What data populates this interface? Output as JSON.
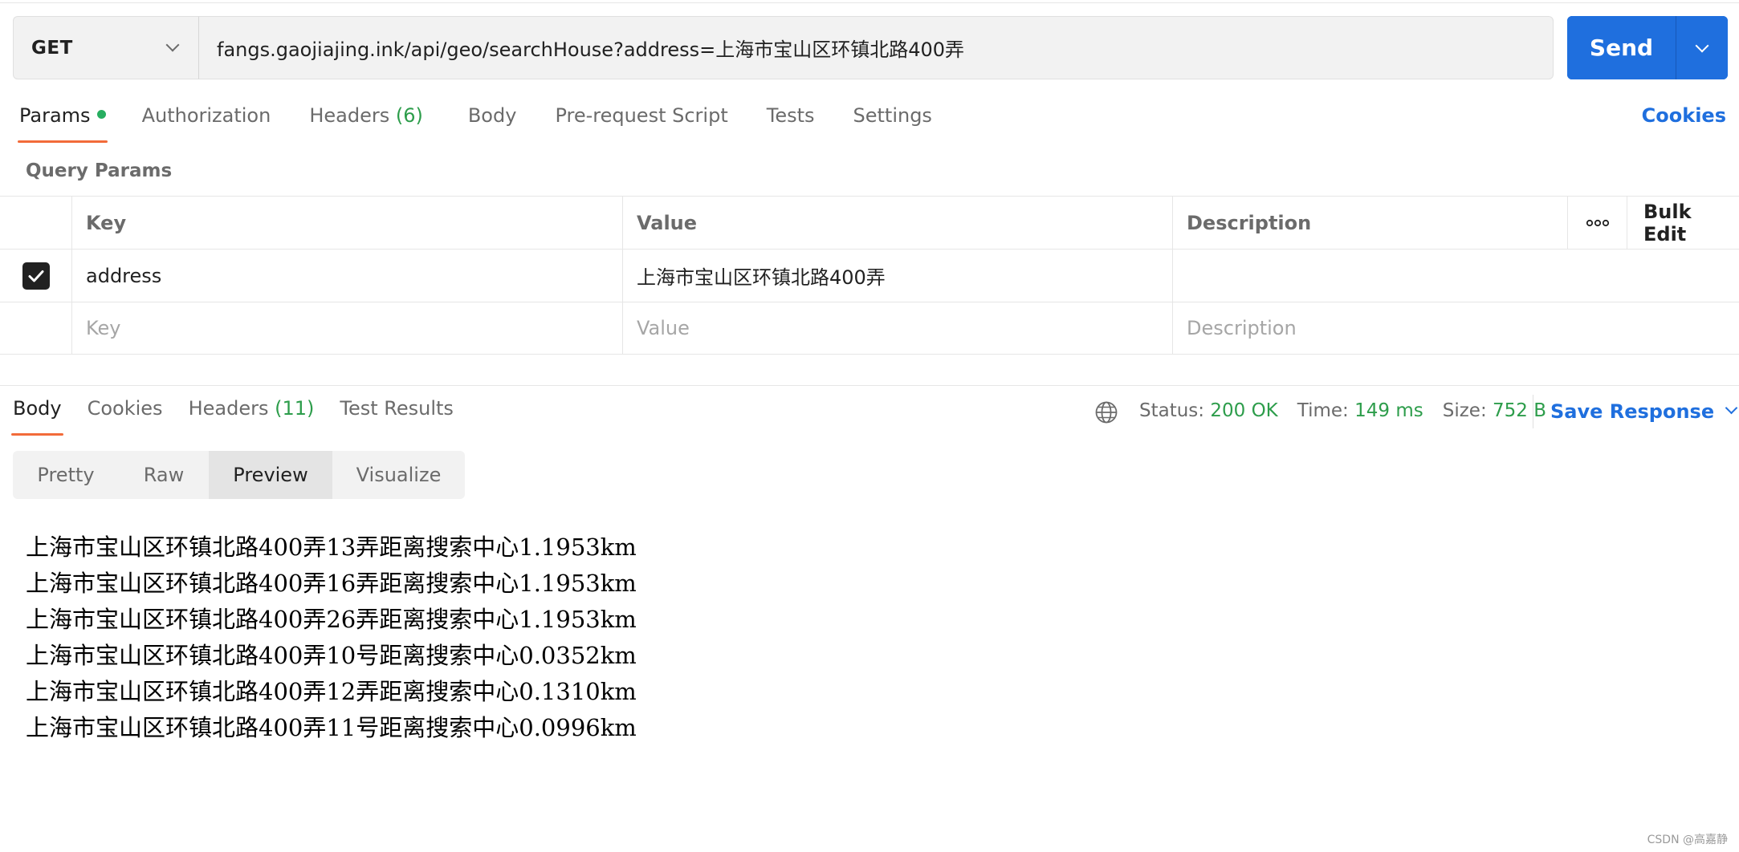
{
  "request": {
    "method": "GET",
    "url": "fangs.gaojiajing.ink/api/geo/searchHouse?address=上海市宝山区环镇北路400弄",
    "send_label": "Send"
  },
  "request_tabs": {
    "params": "Params",
    "authorization": "Authorization",
    "headers": "Headers",
    "headers_count": "(6)",
    "body": "Body",
    "prerequest": "Pre-request Script",
    "tests": "Tests",
    "settings": "Settings",
    "cookies": "Cookies"
  },
  "query_params": {
    "title": "Query Params",
    "columns": {
      "key": "Key",
      "value": "Value",
      "description": "Description",
      "more": "ooo",
      "bulk_edit": "Bulk Edit"
    },
    "rows": [
      {
        "checked": true,
        "key": "address",
        "value": "上海市宝山区环镇北路400弄",
        "description": ""
      }
    ],
    "placeholders": {
      "key": "Key",
      "value": "Value",
      "description": "Description"
    }
  },
  "response_tabs": {
    "body": "Body",
    "cookies": "Cookies",
    "headers": "Headers",
    "headers_count": "(11)",
    "test_results": "Test Results"
  },
  "response_status": {
    "status_label": "Status:",
    "status_value": "200 OK",
    "time_label": "Time:",
    "time_value": "149 ms",
    "size_label": "Size:",
    "size_value": "752 B",
    "save_response": "Save Response"
  },
  "view_modes": {
    "pretty": "Pretty",
    "raw": "Raw",
    "preview": "Preview",
    "visualize": "Visualize",
    "selected": "Preview"
  },
  "preview_lines": [
    "上海市宝山区环镇北路400弄13弄距离搜索中心1.1953km",
    "上海市宝山区环镇北路400弄16弄距离搜索中心1.1953km",
    "上海市宝山区环镇北路400弄26弄距离搜索中心1.1953km",
    "上海市宝山区环镇北路400弄10号距离搜索中心0.0352km",
    "上海市宝山区环镇北路400弄12弄距离搜索中心0.1310km",
    "上海市宝山区环镇北路400弄11号距离搜索中心0.0996km"
  ],
  "watermark": "CSDN @高嘉静",
  "colors": {
    "accent": "#1f6fde",
    "tab_underline": "#f26b3a",
    "success": "#2d9d4b",
    "dot": "#27ae60"
  }
}
